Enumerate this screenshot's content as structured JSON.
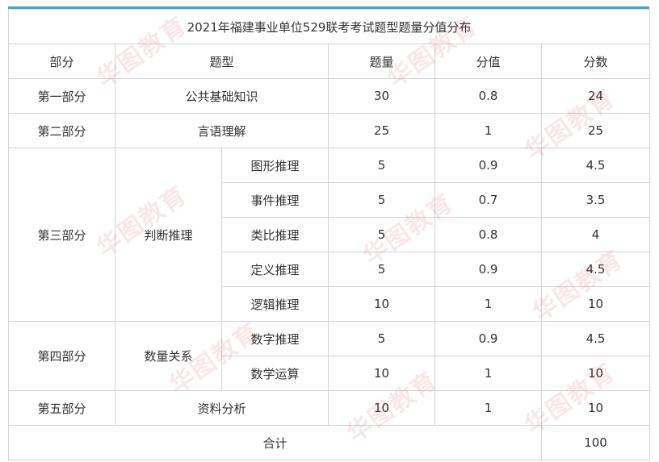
{
  "table": {
    "title": "2021年福建事业单位529联考考试题型题量分值分布",
    "headers": [
      "部分",
      "题型",
      "题量",
      "分值",
      "分数"
    ],
    "rows": {
      "r1": {
        "part": "第一部分",
        "type": "公共基础知识",
        "count": "30",
        "value": "0.8",
        "score": "24"
      },
      "r2": {
        "part": "第二部分",
        "type": "言语理解",
        "count": "25",
        "value": "1",
        "score": "25"
      },
      "r3": {
        "part": "第三部分",
        "group": "判断推理",
        "subs": [
          {
            "type": "图形推理",
            "count": "5",
            "value": "0.9",
            "score": "4.5"
          },
          {
            "type": "事件推理",
            "count": "5",
            "value": "0.7",
            "score": "3.5"
          },
          {
            "type": "类比推理",
            "count": "5",
            "value": "0.8",
            "score": "4"
          },
          {
            "type": "定义推理",
            "count": "5",
            "value": "0.9",
            "score": "4.5"
          },
          {
            "type": "逻辑推理",
            "count": "10",
            "value": "1",
            "score": "10"
          }
        ]
      },
      "r4": {
        "part": "第四部分",
        "group": "数量关系",
        "subs": [
          {
            "type": "数字推理",
            "count": "5",
            "value": "0.9",
            "score": "4.5"
          },
          {
            "type": "数学运算",
            "count": "10",
            "value": "1",
            "score": "10"
          }
        ]
      },
      "r5": {
        "part": "第五部分",
        "type": "资料分析",
        "count": "10",
        "value": "1",
        "score": "10"
      },
      "total": {
        "label": "合计",
        "score": "100"
      }
    }
  },
  "watermark": {
    "text": "华图教育",
    "color": "#c0242b"
  },
  "colors": {
    "accent_rule": "#4aa3c8",
    "border": "#cfd6dc",
    "text": "#333333"
  }
}
